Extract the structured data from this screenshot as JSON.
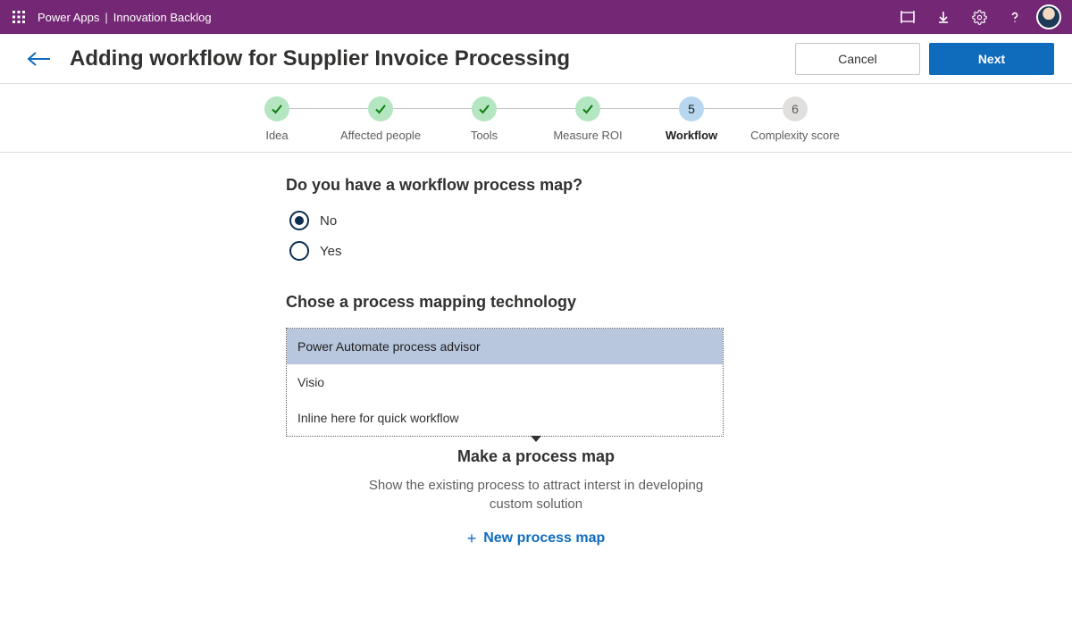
{
  "suite": {
    "app": "Power Apps",
    "solution": "Innovation Backlog"
  },
  "header": {
    "title": "Adding workflow for Supplier Invoice Processing",
    "cancel": "Cancel",
    "next": "Next"
  },
  "steps": [
    {
      "label": "Idea",
      "state": "done"
    },
    {
      "label": "Affected people",
      "state": "done"
    },
    {
      "label": "Tools",
      "state": "done"
    },
    {
      "label": "Measure ROI",
      "state": "done"
    },
    {
      "label": "Workflow",
      "state": "current",
      "num": "5"
    },
    {
      "label": "Complexity score",
      "state": "future",
      "num": "6"
    }
  ],
  "question1": {
    "heading": "Do you have a workflow process map?",
    "options": {
      "no": "No",
      "yes": "Yes"
    },
    "selected": "no"
  },
  "question2": {
    "heading": "Chose a process mapping technology",
    "options": [
      "Power Automate process advisor",
      "Visio",
      "Inline here for quick workflow"
    ],
    "selectedIndex": 0
  },
  "mapSection": {
    "title": "Make a process map",
    "desc": "Show the existing process to attract interst in developing custom solution",
    "addLabel": "New process map"
  }
}
